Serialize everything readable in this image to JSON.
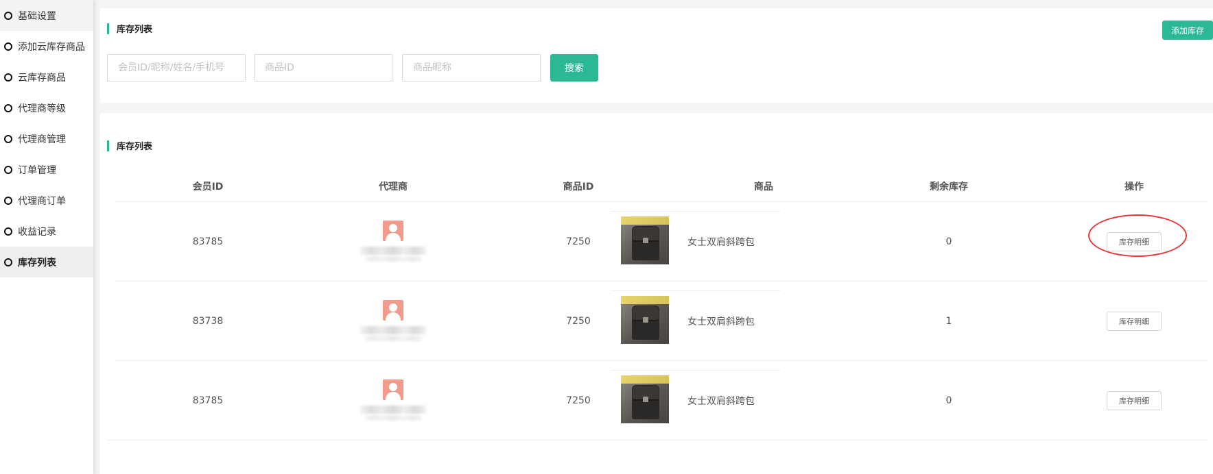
{
  "sidebar": {
    "items": [
      {
        "label": "基础设置"
      },
      {
        "label": "添加云库存商品"
      },
      {
        "label": "云库存商品"
      },
      {
        "label": "代理商等级"
      },
      {
        "label": "代理商管理"
      },
      {
        "label": "订单管理"
      },
      {
        "label": "代理商订单"
      },
      {
        "label": "收益记录"
      },
      {
        "label": "库存列表"
      }
    ],
    "active_index": 8
  },
  "filter_panel": {
    "title": "库存列表",
    "add_button": "添加库存",
    "inputs": [
      {
        "placeholder": "会员ID/昵称/姓名/手机号",
        "value": ""
      },
      {
        "placeholder": "商品ID",
        "value": ""
      },
      {
        "placeholder": "商品昵称",
        "value": ""
      }
    ],
    "search_button": "搜索"
  },
  "list_panel": {
    "title": "库存列表",
    "columns": [
      "会员ID",
      "代理商",
      "商品ID",
      "商品",
      "剩余库存",
      "操作"
    ],
    "rows": [
      {
        "member_id": "83785",
        "product_id": "7250",
        "product_name": "女士双肩斜跨包",
        "stock": "0",
        "action": "库存明细",
        "highlighted": true
      },
      {
        "member_id": "83738",
        "product_id": "7250",
        "product_name": "女士双肩斜跨包",
        "stock": "1",
        "action": "库存明细",
        "highlighted": false
      },
      {
        "member_id": "83785",
        "product_id": "7250",
        "product_name": "女士双肩斜跨包",
        "stock": "0",
        "action": "库存明细",
        "highlighted": false
      }
    ]
  },
  "colors": {
    "accent": "#2bb895",
    "highlight": "#e53935",
    "avatar": "#f29b8c"
  }
}
